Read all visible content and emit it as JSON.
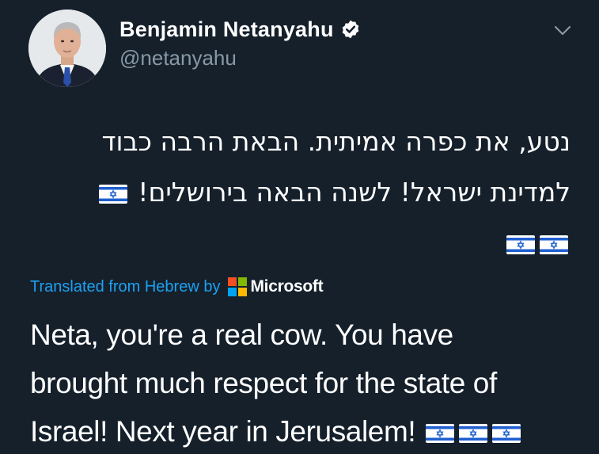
{
  "tweet": {
    "author": {
      "display_name": "Benjamin Netanyahu",
      "handle": "@netanyahu",
      "verified": true,
      "avatar": "profile-photo"
    },
    "menu_icon": "chevron-down-icon",
    "original_text": {
      "language": "Hebrew",
      "lines": [
        "נטע, את כפרה אמיתית. הבאת הרבה כבוד",
        "למדינת ישראל! לשנה הבאה בירושלים!"
      ],
      "flag_emoji": "israel-flag-icon"
    },
    "translation": {
      "label": "Translated from Hebrew by",
      "provider": "Microsoft",
      "label_color": "#1da1f2",
      "lines": [
        "Neta, you're a real cow. You have",
        "brought much respect for the state of",
        "Israel! Next year in Jerusalem!"
      ]
    }
  },
  "theme": {
    "background": "#15202b",
    "text": "#ffffff",
    "secondary_text": "#8899a6",
    "accent": "#1da1f2"
  }
}
